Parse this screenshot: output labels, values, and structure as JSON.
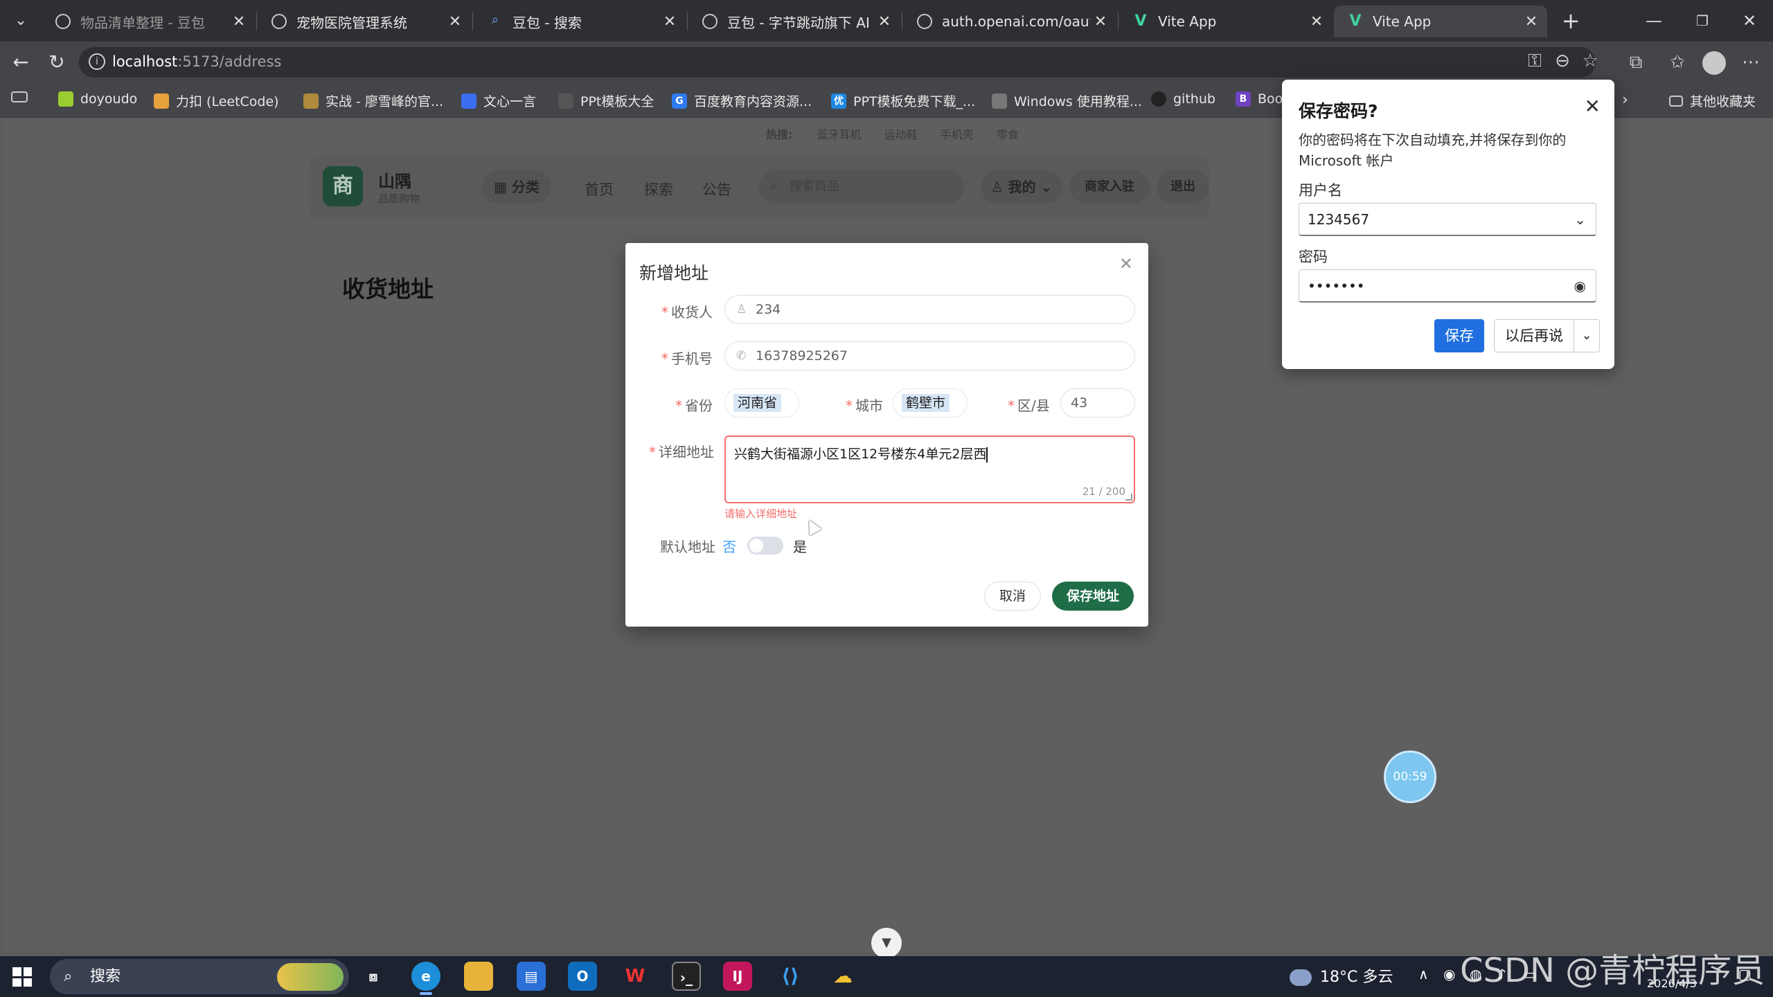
{
  "browser": {
    "tabs": [
      {
        "title": "物品清单整理 - 豆包",
        "icon": "doubao-icon"
      },
      {
        "title": "宠物医院管理系统",
        "icon": "globe-icon"
      },
      {
        "title": "豆包 - 搜索",
        "icon": "search-icon"
      },
      {
        "title": "豆包 - 字节跳动旗下 AI 智能",
        "icon": "doubao-icon"
      },
      {
        "title": "auth.openai.com/oauth/auth",
        "icon": "globe-icon"
      },
      {
        "title": "Vite App",
        "icon": "vite-icon"
      },
      {
        "title": "Vite App",
        "icon": "vite-icon"
      }
    ],
    "url_host": "localhost",
    "url_path": ":5173/address",
    "bookmarks": [
      {
        "label": "doyoudo"
      },
      {
        "label": "力扣 (LeetCode)"
      },
      {
        "label": "实战 - 廖雪峰的官..."
      },
      {
        "label": "文心一言"
      },
      {
        "label": "PPt模板大全"
      },
      {
        "label": "百度教育内容资源..."
      },
      {
        "label": "PPT模板免费下载_..."
      },
      {
        "label": "Windows 使用教程..."
      },
      {
        "label": "github"
      },
      {
        "label": "Boot"
      }
    ],
    "other_bookmarks": "其他收藏夹"
  },
  "site": {
    "hot_label": "热搜:",
    "hot_words": [
      "蓝牙耳机",
      "运动鞋",
      "手机壳",
      "零食"
    ],
    "logo_char": "商",
    "name": "山隅",
    "tagline": "品质购物",
    "category_btn": "分类",
    "nav": [
      "首页",
      "探索",
      "公告"
    ],
    "search_placeholder": "搜索商品",
    "my_btn": "我的",
    "merchant_btn": "商家入驻",
    "logout_btn": "退出",
    "page_title": "收货地址"
  },
  "modal": {
    "title": "新增地址",
    "receiver_label": "收货人",
    "receiver_value": "234",
    "phone_label": "手机号",
    "phone_value": "16378925267",
    "province_label": "省份",
    "province_value": "河南省",
    "city_label": "城市",
    "city_value": "鹤壁市",
    "district_label": "区/县",
    "district_value": "43",
    "detail_label": "详细地址",
    "detail_value": "兴鹤大街福源小区1区12号楼东4单元2层西",
    "detail_count": "21 / 200",
    "detail_error": "请输入详细地址",
    "default_label": "默认地址",
    "default_off": "否",
    "default_on": "是",
    "default_checked": false,
    "cancel_btn": "取消",
    "save_btn": "保存地址"
  },
  "password_popup": {
    "title": "保存密码?",
    "desc": "你的密码将在下次自动填充,并将保存到你的 Microsoft 帐户",
    "username_label": "用户名",
    "username_value": "1234567",
    "password_label": "密码",
    "password_value": "•••••••",
    "save_btn": "保存",
    "later_btn": "以后再说"
  },
  "timer": "00:59",
  "taskbar": {
    "search_label": "搜索",
    "weather": "18°C 多云",
    "date": "2026/4/3"
  },
  "watermark": "CSDN @青柠程序员"
}
